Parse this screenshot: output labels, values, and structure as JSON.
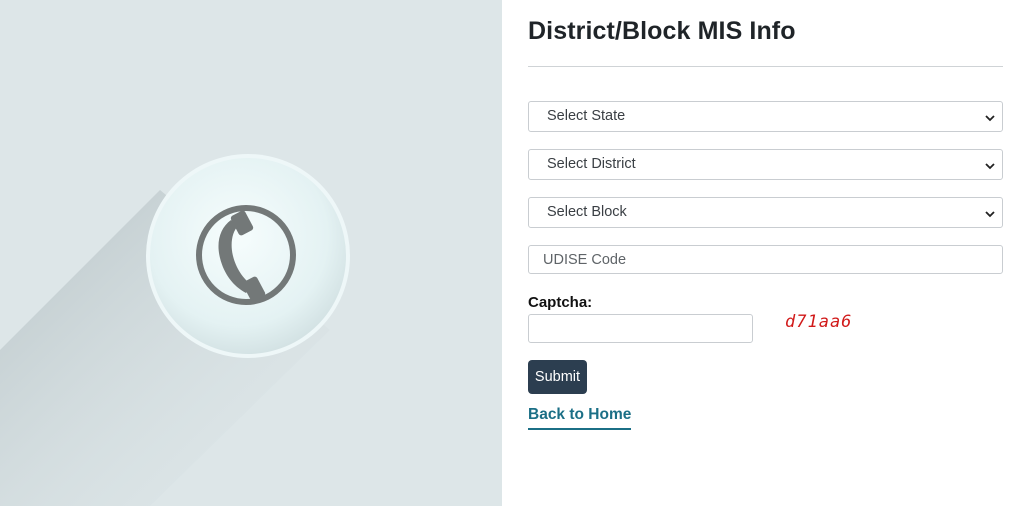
{
  "form": {
    "title": "District/Block MIS Info",
    "state_select": {
      "selected": "Select State"
    },
    "district_select": {
      "selected": "Select District"
    },
    "block_select": {
      "selected": "Select Block"
    },
    "udise_input": {
      "placeholder": "UDISE Code",
      "value": ""
    },
    "captcha_label": "Captcha:",
    "captcha_input": {
      "value": ""
    },
    "captcha_code": "d71aa6",
    "submit_label": "Submit",
    "back_link_label": "Back to Home"
  },
  "colors": {
    "left_bg": "#dde6e8",
    "submit_bg": "#2c3e50",
    "link": "#1b6f86",
    "captcha_text": "#d11a1a"
  },
  "icons": {
    "illustration": "phone-icon",
    "select_caret": "chevron-down-icon"
  }
}
